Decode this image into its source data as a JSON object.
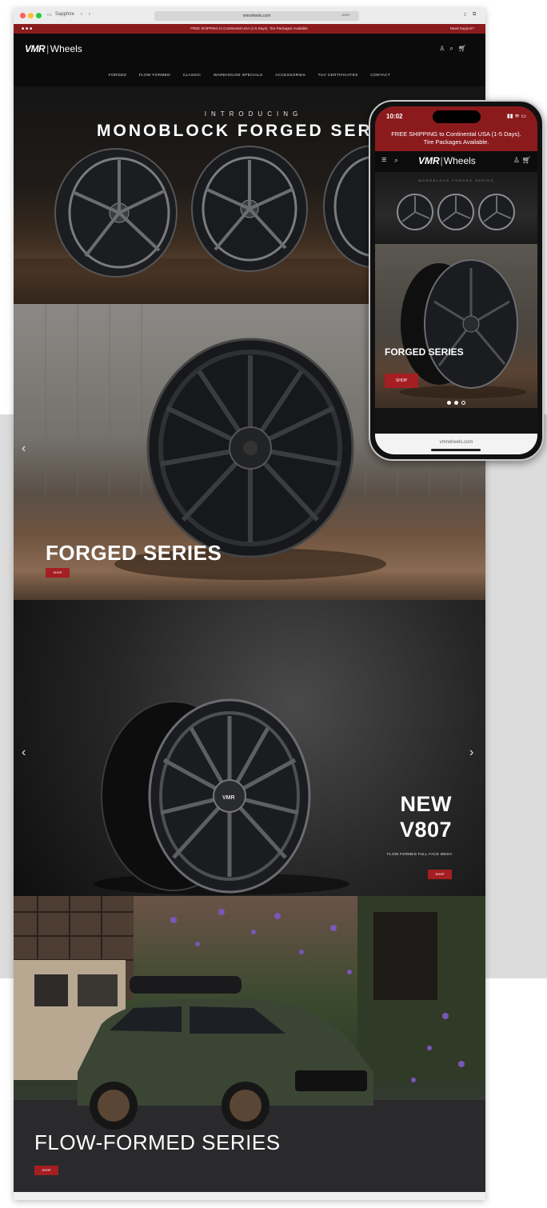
{
  "desktop": {
    "chrome": {
      "tab_label": "Sapphire",
      "url": "vmrwheels.com",
      "aux": "100%"
    },
    "announcement": {
      "text": "FREE SHIPPING to Continental USA (1-5 Days). Tire Packages Available.",
      "right_text": "Need Support?"
    },
    "logo": {
      "mark": "VMR",
      "word": "Wheels"
    },
    "nav_items": [
      "FORGED",
      "FLOW FORMED",
      "CLASSIC",
      "WAREHOUSE SPECIALS",
      "ACCESSORIES",
      "TUV CERTIFICATES",
      "CONTACT"
    ],
    "hero": {
      "intro": "INTRODUCING",
      "title": "MONOBLOCK FORGED SERIES"
    },
    "slides": [
      {
        "title": "FORGED SERIES",
        "button": "SHOP"
      },
      {
        "title_line1": "NEW",
        "title_line2": "V807",
        "subtitle": "FLOW FORMED FULL FACE MESH",
        "button": "SHOP"
      },
      {
        "title": "FLOW-FORMED SERIES",
        "button": "SHOP"
      }
    ]
  },
  "phone": {
    "time": "10:02",
    "announcement_line1": "FREE SHIPPING to Continental USA (1-5 Days).",
    "announcement_line2": "Tire Packages Available.",
    "logo": {
      "mark": "VMR",
      "word": "Wheels"
    },
    "hero_tag": "MONOBLOCK FORGED SERIES",
    "slide_title": "FORGED SERIES",
    "shop_label": "SHOP",
    "url_bar": "vmrwheels.com"
  },
  "icons": {
    "desktop_header": [
      "user-icon",
      "search-icon",
      "cart-icon"
    ],
    "phone_header": [
      "menu-icon",
      "search-icon",
      "user-icon",
      "cart-icon"
    ]
  },
  "colors": {
    "brand_red": "#8b1a1d",
    "button_red": "#a51e22",
    "header_bg": "#0b0b0b"
  }
}
